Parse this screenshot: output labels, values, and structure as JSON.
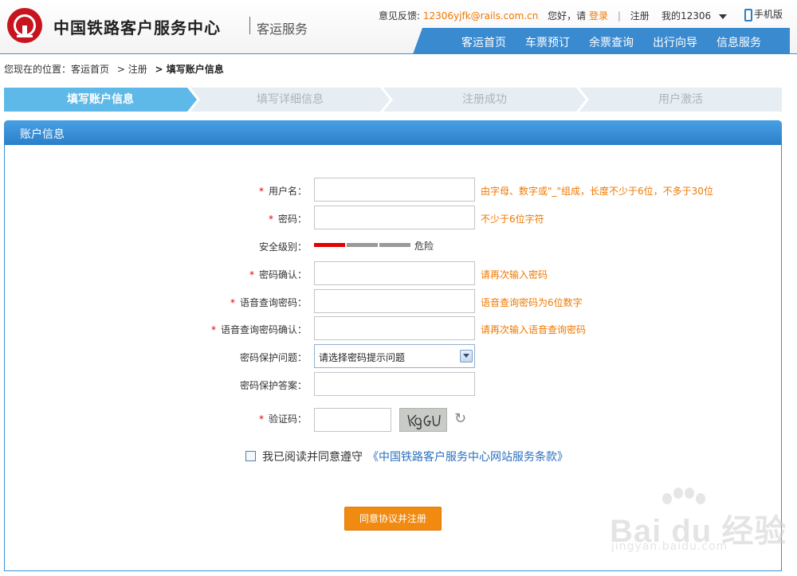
{
  "header": {
    "brand": "中国铁路客户服务中心",
    "brand_sub": "客运服务",
    "feedback_label": "意见反馈:",
    "feedback_email": "12306yjfk@rails.com.cn",
    "greeting": "您好，请",
    "login": "登录",
    "register": "注册",
    "my12306": "我的12306",
    "mobile": "手机版"
  },
  "nav": [
    "客运首页",
    "车票预订",
    "余票查询",
    "出行向导",
    "信息服务"
  ],
  "breadcrumb": {
    "prefix": "您现在的位置：客运首页",
    "mid": "> 注册",
    "current": "> 填写账户信息"
  },
  "steps": [
    "填写账户信息",
    "填写详细信息",
    "注册成功",
    "用户激活"
  ],
  "panel_title": "账户信息",
  "form": {
    "username_label": "用户名：",
    "username_hint": "由字母、数字或\"_\"组成，长度不少于6位，不多于30位",
    "password_label": "密码：",
    "password_hint": "不少于6位字符",
    "strength_label": "安全级别：",
    "strength_value": "危险",
    "strength_level": 1,
    "confirm_label": "密码确认：",
    "confirm_hint": "请再次输入密码",
    "voice_label": "语音查询密码：",
    "voice_hint": "语音查询密码为6位数字",
    "voice_confirm_label": "语音查询密码确认：",
    "voice_confirm_hint": "请再次输入语音查询密码",
    "question_label": "密码保护问题：",
    "question_selected": "请选择密码提示问题",
    "answer_label": "密码保护答案：",
    "captcha_label": "验证码：",
    "captcha_text": "K9GU",
    "agree_text": "我已阅读并同意遵守",
    "agree_link": "《中国铁路客户服务中心网站服务条款》",
    "submit": "同意协议并注册"
  },
  "watermark": {
    "big": "Bai du 经验",
    "small": "jingyan.baidu.com"
  },
  "colors": {
    "brand_red": "#c8141e",
    "nav_blue": "#3a8ad0",
    "step_active": "#5eb9e8",
    "hint_orange": "#f07800",
    "submit_orange": "#f08a10",
    "strength_red": "#e30000"
  }
}
